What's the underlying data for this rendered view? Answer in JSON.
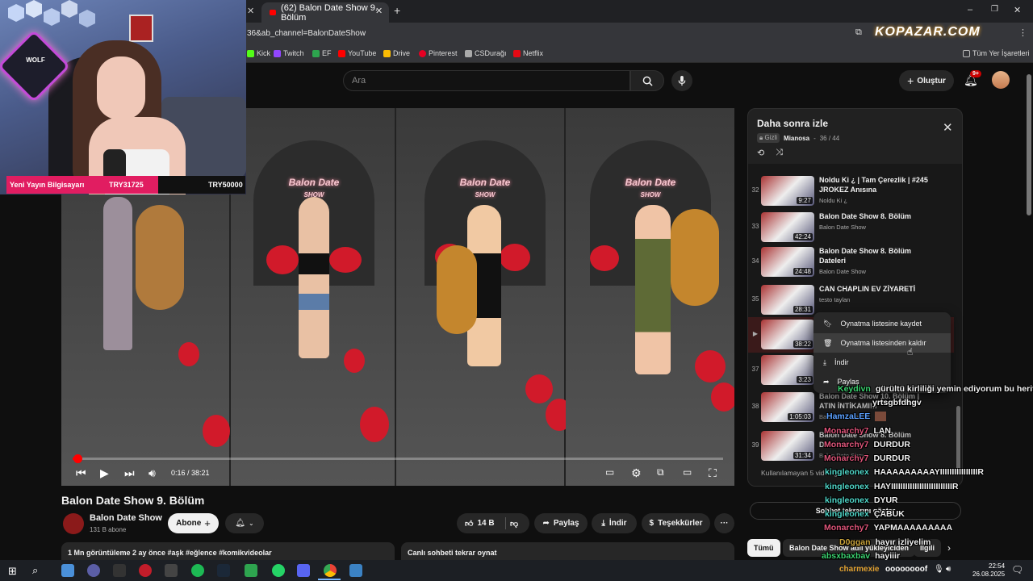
{
  "browser": {
    "tab_title": "(62) Balon Date Show 9. Bölüm",
    "url": "36&ab_channel=BalonDateShow",
    "ad_text": "KOPAZAR.COM",
    "bookmarks": [
      "Kick",
      "Twitch",
      "EF",
      "YouTube",
      "Drive",
      "Pinterest",
      "CSDurağı",
      "Netflix"
    ],
    "other_bookmarks": "Tüm Yer İşaretleri",
    "window_controls": [
      "–",
      "❐",
      "✕"
    ]
  },
  "header": {
    "search_placeholder": "Ara",
    "create_label": "Oluştur",
    "notif_count": "9+"
  },
  "player": {
    "time": "0:16 / 38:21",
    "progress_fraction": 0.007,
    "sign_text": "Balon Date",
    "sign_sub": "SHOW"
  },
  "video": {
    "title": "Balon Date Show 9. Bölüm",
    "channel": "Balon Date Show",
    "subs": "131 B abone",
    "subscribe": "Abone",
    "likes": "14 B",
    "share": "Paylaş",
    "download": "İndir",
    "thanks": "Teşekkürler",
    "more": "···",
    "desc": "1 Mn görüntüleme  2 ay önce  #aşk #eğlence #komikvideolar",
    "replay": "Canlı sohbeti tekrar oynat"
  },
  "playlist": {
    "title": "Daha sonra izle",
    "privacy": "Gizli",
    "owner": "Mianosa",
    "position": "36 / 44",
    "items": [
      {
        "idx": "32",
        "title": "Noldu Ki ¿ | Tam Çerezlik | #245 JROKEZ Anısına",
        "channel": "Noldu Ki ¿",
        "dur": "9:27"
      },
      {
        "idx": "33",
        "title": "Balon Date Show 8. Bölüm",
        "channel": "Balon Date Show",
        "dur": "42:24"
      },
      {
        "idx": "34",
        "title": "Balon Date Show 8. Bölüm Dateleri",
        "channel": "Balon Date Show",
        "dur": "24:48"
      },
      {
        "idx": "35",
        "title": "CAN CHAPLIN EV ZİYARETİ",
        "channel": "testo taylan",
        "dur": "28:31"
      },
      {
        "idx": "▶",
        "title": "",
        "channel": "",
        "dur": "38:22"
      },
      {
        "idx": "37",
        "title": "",
        "channel": "",
        "dur": "3:23"
      },
      {
        "idx": "38",
        "title": "Balon Date Show 10. Bölüm | ATIN İNTİKAMI!!!",
        "channel": "Balon Date Show",
        "dur": "1:05:03"
      },
      {
        "idx": "39",
        "title": "Balon Date Show 8. Bölüm Dateleri",
        "channel": "Balon Date Show",
        "dur": "31:34"
      }
    ],
    "unavailable": "Kullanılamayan 5 video gizlendi"
  },
  "context_menu": [
    {
      "icon": "bookmark-icon",
      "label": "Oynatma listesine kaydet"
    },
    {
      "icon": "trash-icon",
      "label": "Oynatma listesinden kaldır"
    },
    {
      "icon": "download-icon",
      "label": "İndir"
    },
    {
      "icon": "share-icon",
      "label": "Paylaş"
    }
  ],
  "chat_button": "Sohbet tekrarını göster",
  "chips": [
    "Tümü",
    "Balon Date Show adlı yükleyiciden",
    "İlgili"
  ],
  "chat": [
    {
      "user": "Keydivn",
      "msg": "gürültü kirliliği yemin ediyorum bu herif",
      "color": "#3bd16f"
    },
    {
      "user": "",
      "msg": "yrtsgbfdhgv",
      "color": "#ffffff"
    },
    {
      "user": "HamzaLEE",
      "msg": "",
      "color": "#5aa0ff"
    },
    {
      "user": "Monarchy7",
      "msg": "LAN",
      "color": "#e0557a"
    },
    {
      "user": "Monarchy7",
      "msg": "DURDUR",
      "color": "#e0557a"
    },
    {
      "user": "Monarchy7",
      "msg": "DURDUR",
      "color": "#e0557a"
    },
    {
      "user": "kingleonex",
      "msg": "HAAAAAAAAAYIIIIIIIIIIIIIIIIR",
      "color": "#4fd6c8"
    },
    {
      "user": "kingleonex",
      "msg": "HAYIIIIIIIIIIIIIIIIIIIIIIIIIIR",
      "color": "#4fd6c8"
    },
    {
      "user": "kingleonex",
      "msg": "DYUR",
      "color": "#4fd6c8"
    },
    {
      "user": "kingleonex",
      "msg": "ÇABUK",
      "color": "#4fd6c8"
    },
    {
      "user": "Monarchy7",
      "msg": "YAPMAAAAAAAAA",
      "color": "#e0557a"
    },
    {
      "user": "D0ggan",
      "msg": "hayır izliyelim",
      "color": "#c8a23a"
    },
    {
      "user": "absxbaxbav",
      "msg": "hayiiir",
      "color": "#3bd16f"
    },
    {
      "user": "charmexie",
      "msg": "oooooooof",
      "color": "#e0a030"
    }
  ],
  "stream_overlay": {
    "label": "Yeni Yayın Bilgisayarı",
    "goal1": "TRY31725",
    "goal2": "TRY50000",
    "logo_text": "WOLF"
  },
  "taskbar": {
    "time": "22:54",
    "date": "26.08.2025"
  }
}
